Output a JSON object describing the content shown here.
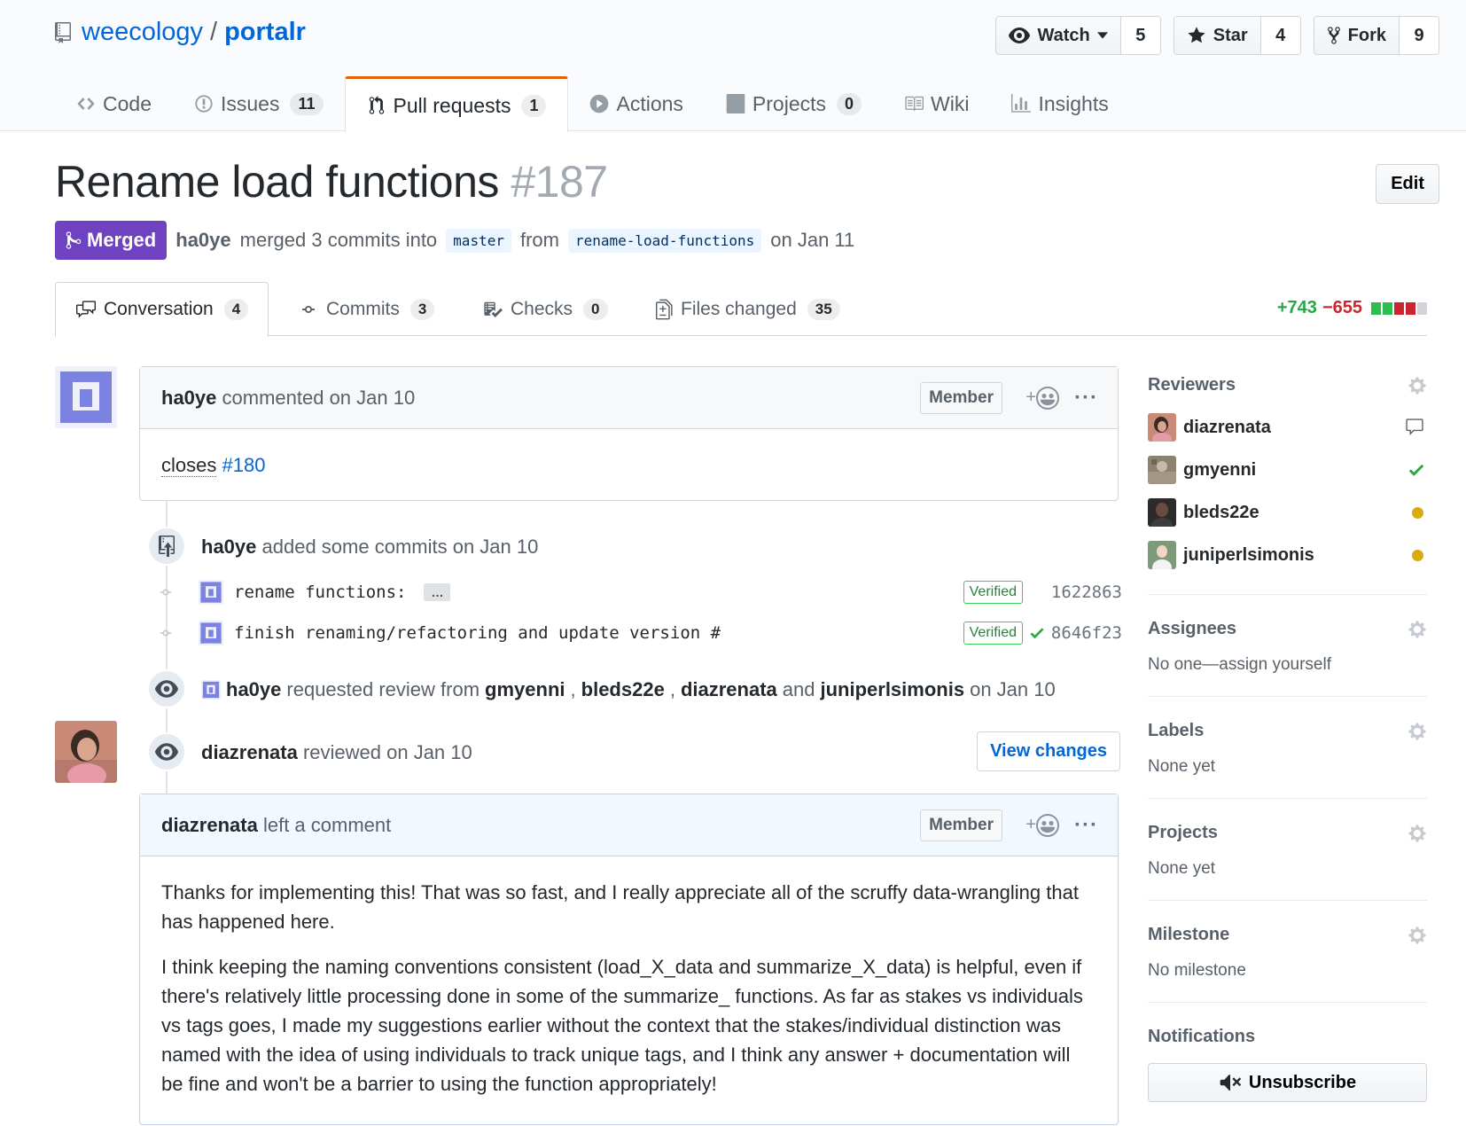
{
  "repo": {
    "owner": "weecology",
    "separator": "/",
    "name": "portalr"
  },
  "actions": {
    "watch": {
      "label": "Watch",
      "count": "5"
    },
    "star": {
      "label": "Star",
      "count": "4"
    },
    "fork": {
      "label": "Fork",
      "count": "9"
    }
  },
  "nav": {
    "code": "Code",
    "issues": {
      "label": "Issues",
      "count": "11"
    },
    "pulls": {
      "label": "Pull requests",
      "count": "1"
    },
    "actions": "Actions",
    "projects": {
      "label": "Projects",
      "count": "0"
    },
    "wiki": "Wiki",
    "insights": "Insights"
  },
  "pr": {
    "title": "Rename load functions",
    "number": "#187",
    "edit": "Edit",
    "state": "Merged",
    "author": "ha0ye",
    "merged_text": "merged 3 commits into",
    "base": "master",
    "from_text": "from",
    "head": "rename-load-functions",
    "date_text": "on Jan 11"
  },
  "tabs": {
    "conversation": {
      "label": "Conversation",
      "count": "4"
    },
    "commits": {
      "label": "Commits",
      "count": "3"
    },
    "checks": {
      "label": "Checks",
      "count": "0"
    },
    "files": {
      "label": "Files changed",
      "count": "35"
    },
    "additions": "+743",
    "deletions": "−655"
  },
  "comment1": {
    "author": "ha0ye",
    "action": "commented on Jan 10",
    "badge": "Member",
    "reaction": "+",
    "more": "···",
    "body_prefix": "closes",
    "body_link": "#180"
  },
  "commits_event": {
    "author": "ha0ye",
    "text": "added some commits on Jan 10",
    "items": [
      {
        "message": "rename functions:",
        "ellipsis": "…",
        "verified": "Verified",
        "sha": "1622863"
      },
      {
        "message": "finish renaming/refactoring and update version #",
        "verified": "Verified",
        "sha": "8646f23"
      }
    ]
  },
  "review_request": {
    "author": "ha0ye",
    "text": "requested review from",
    "r1": "gmyenni",
    "comma1": ",",
    "r2": "bleds22e",
    "comma2": ",",
    "r3": "diazrenata",
    "and": "and",
    "r4": "juniperlsimonis",
    "date": "on Jan 10"
  },
  "review": {
    "author": "diazrenata",
    "text": "reviewed on Jan 10",
    "view_changes": "View changes"
  },
  "comment2": {
    "author": "diazrenata",
    "action": "left a comment",
    "badge": "Member",
    "reaction": "+",
    "more": "···",
    "p1": "Thanks for implementing this! That was so fast, and I really appreciate all of the scruffy data-wrangling that has happened here.",
    "p2": "I think keeping the naming conventions consistent (load_X_data and summarize_X_data) is helpful, even if there's relatively little processing done in some of the summarize_ functions. As far as stakes vs individuals vs tags goes, I made my suggestions earlier without the context that the stakes/individual distinction was named with the idea of using individuals to track unique tags, and I think any answer + documentation will be fine and won't be a barrier to using the function appropriately!"
  },
  "sidebar": {
    "reviewers": {
      "heading": "Reviewers",
      "items": [
        {
          "name": "diazrenata",
          "status": "commented"
        },
        {
          "name": "gmyenni",
          "status": "approved"
        },
        {
          "name": "bleds22e",
          "status": "pending"
        },
        {
          "name": "juniperlsimonis",
          "status": "pending"
        }
      ]
    },
    "assignees": {
      "heading": "Assignees",
      "empty": "No one—assign yourself"
    },
    "labels": {
      "heading": "Labels",
      "empty": "None yet"
    },
    "projects": {
      "heading": "Projects",
      "empty": "None yet"
    },
    "milestone": {
      "heading": "Milestone",
      "empty": "No milestone"
    },
    "notifications": {
      "heading": "Notifications",
      "unsubscribe": "Unsubscribe"
    }
  },
  "colors": {
    "link": "#0366d6",
    "merged": "#6f42c1",
    "tab_accent": "#e36209",
    "additions": "#28a745",
    "deletions": "#cb2431",
    "pending": "#dbab09"
  }
}
